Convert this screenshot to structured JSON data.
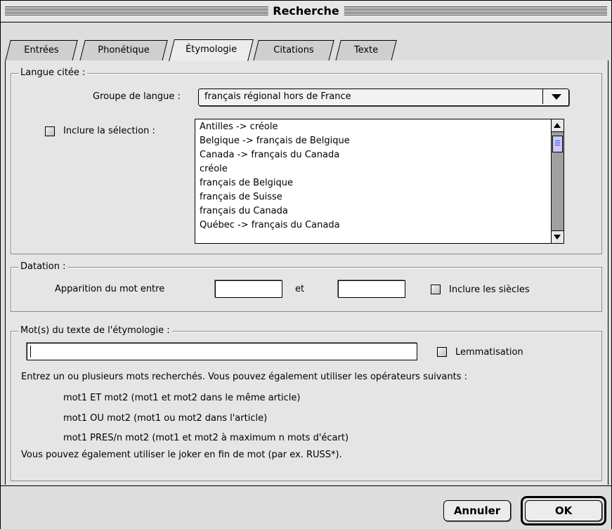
{
  "window": {
    "title": "Recherche"
  },
  "tabs": [
    {
      "label": "Entrées",
      "active": false
    },
    {
      "label": "Phonétique",
      "active": false
    },
    {
      "label": "Étymologie",
      "active": true
    },
    {
      "label": "Citations",
      "active": false
    },
    {
      "label": "Texte",
      "active": false
    }
  ],
  "langue": {
    "legend": "Langue citée :",
    "groupe_label": "Groupe de langue :",
    "groupe_value": "français régional hors de France",
    "inclure_label": "Inclure la sélection :",
    "items": [
      "Antilles -> créole",
      "Belgique -> français de Belgique",
      "Canada -> français du Canada",
      "créole",
      "français de Belgique",
      "français de Suisse",
      "français du Canada",
      "Québec -> français du Canada"
    ]
  },
  "datation": {
    "legend": "Datation :",
    "apparition_label": "Apparition du mot entre",
    "et_label": "et",
    "from_value": "",
    "to_value": "",
    "siecles_label": "Inclure les siècles"
  },
  "mots": {
    "legend": "Mot(s) du texte de l'étymologie :",
    "value": "",
    "lemmatisation_label": "Lemmatisation",
    "help_intro": "Entrez un ou plusieurs mots recherchés. Vous pouvez également utiliser les opérateurs suivants :",
    "op1": "mot1 ET mot2 (mot1 et mot2 dans le même article)",
    "op2": "mot1 OU mot2 (mot1 ou mot2 dans l'article)",
    "op3": "mot1 PRES/n mot2 (mot1 et mot2 à maximum n mots d'écart)",
    "help_joker": "Vous pouvez également utiliser le joker en fin de mot (par ex. RUSS*)."
  },
  "buttons": {
    "cancel": "Annuler",
    "ok": "OK"
  }
}
